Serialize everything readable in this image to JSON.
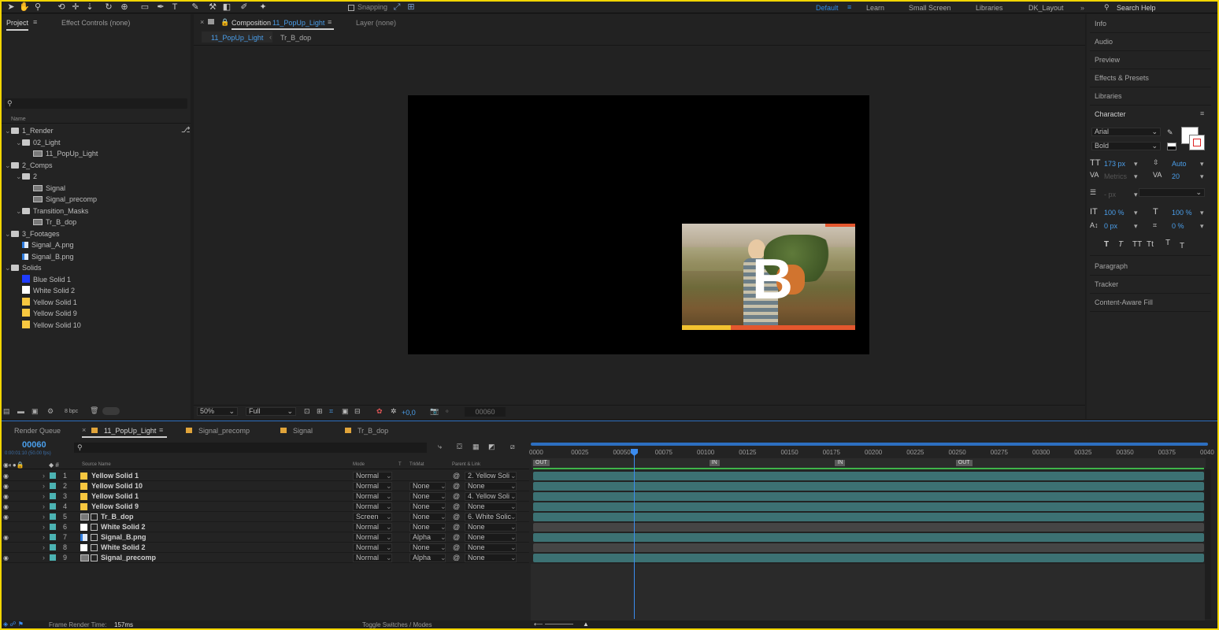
{
  "toolbar": {
    "snapping_label": "Snapping",
    "workspaces": [
      "Default",
      "Learn",
      "Small Screen",
      "Libraries",
      "DK_Layout"
    ],
    "search_placeholder": "Search Help"
  },
  "project_panel": {
    "tabs": [
      "Project",
      "Effect Controls (none)"
    ],
    "column_name": "Name",
    "items": [
      {
        "name": "1_Render",
        "type": "folder",
        "level": 0,
        "expanded": true
      },
      {
        "name": "02_Light",
        "type": "folder",
        "level": 1,
        "expanded": true
      },
      {
        "name": "11_PopUp_Light",
        "type": "comp",
        "level": 2
      },
      {
        "name": "2_Comps",
        "type": "folder",
        "level": 0,
        "expanded": true
      },
      {
        "name": "2",
        "type": "folder",
        "level": 1,
        "expanded": true
      },
      {
        "name": "Signal",
        "type": "comp",
        "level": 2
      },
      {
        "name": "Signal_precomp",
        "type": "comp",
        "level": 2
      },
      {
        "name": "Transition_Masks",
        "type": "folder",
        "level": 1,
        "expanded": true
      },
      {
        "name": "Tr_B_dop",
        "type": "comp",
        "level": 2
      },
      {
        "name": "3_Footages",
        "type": "folder",
        "level": 0,
        "expanded": true
      },
      {
        "name": "Signal_A.png",
        "type": "file",
        "level": 1
      },
      {
        "name": "Signal_B.png",
        "type": "file",
        "level": 1
      },
      {
        "name": "Solids",
        "type": "folder",
        "level": 0,
        "expanded": true
      },
      {
        "name": "Blue Solid 1",
        "type": "solid",
        "color": "#1f3cff",
        "level": 1
      },
      {
        "name": "White Solid 2",
        "type": "solid",
        "color": "#ffffff",
        "level": 1
      },
      {
        "name": "Yellow Solid 1",
        "type": "solid",
        "color": "#f7c740",
        "level": 1
      },
      {
        "name": "Yellow Solid 9",
        "type": "solid",
        "color": "#f7c740",
        "level": 1
      },
      {
        "name": "Yellow Solid 10",
        "type": "solid",
        "color": "#f7c740",
        "level": 1
      }
    ],
    "bpc": "8 bpc"
  },
  "composition_panel": {
    "tab_prefix": "Composition",
    "tab_comp": "11_PopUp_Light",
    "layer_tab": "Layer  (none)",
    "breadcrumbs": [
      "11_PopUp_Light",
      "Tr_B_dop"
    ],
    "letter": "B",
    "zoom": "50%",
    "resolution": "Full",
    "exposure": "+0,0",
    "frame": "00060",
    "colors": {
      "stripe_yellow": "#f2c230",
      "stripe_orange": "#e4572e"
    }
  },
  "right_panel": {
    "items_top": [
      "Info",
      "Audio",
      "Preview",
      "Effects & Presets",
      "Libraries"
    ],
    "character": {
      "title": "Character",
      "font": "Arial",
      "style": "Bold",
      "size": "173 px",
      "leading": "Auto",
      "kerning": "Metrics",
      "tracking": "20",
      "stroke_unit": "- px",
      "vscale": "100 %",
      "hscale": "100 %",
      "baseline": "0 px",
      "tsume": "0 %",
      "style_buttons": [
        "T",
        "T",
        "TT",
        "Tt",
        "T",
        "T"
      ]
    },
    "items_bottom": [
      "Paragraph",
      "Tracker",
      "Content-Aware Fill"
    ]
  },
  "timeline": {
    "tabs": [
      "Render Queue",
      "11_PopUp_Light",
      "Signal_precomp",
      "Signal",
      "Tr_B_dop"
    ],
    "timecode": "00060",
    "timecode_sub": "0:00:01:10 (50.00 fps)",
    "headers": {
      "source": "Source Name",
      "mode": "Mode",
      "t": "T",
      "trkmat": "TrkMat",
      "parent": "Parent & Link"
    },
    "layers": [
      {
        "num": "1",
        "name": "Yellow Solid 1",
        "icon": "yellow",
        "mode": "Normal",
        "trkmat": "",
        "parent": "2. Yellow Soli",
        "eye": true,
        "bar": "teal"
      },
      {
        "num": "2",
        "name": "Yellow Solid 10",
        "icon": "yellow",
        "mode": "Normal",
        "trkmat": "None",
        "parent": "None",
        "eye": true,
        "bar": "teal"
      },
      {
        "num": "3",
        "name": "Yellow Solid 1",
        "icon": "yellow",
        "mode": "Normal",
        "trkmat": "None",
        "parent": "4. Yellow Soli",
        "eye": true,
        "bar": "teal"
      },
      {
        "num": "4",
        "name": "Yellow Solid 9",
        "icon": "yellow",
        "mode": "Normal",
        "trkmat": "None",
        "parent": "None",
        "eye": true,
        "bar": "teal"
      },
      {
        "num": "5",
        "name": "Tr_B_dop",
        "icon": "comp",
        "mode": "Screen",
        "trkmat": "None",
        "parent": "6. White Solic",
        "eye": true,
        "bar": "teal"
      },
      {
        "num": "6",
        "name": "White Solid 2",
        "icon": "white",
        "mode": "Normal",
        "trkmat": "None",
        "parent": "None",
        "eye": false,
        "bar": "gray"
      },
      {
        "num": "7",
        "name": "Signal_B.png",
        "icon": "file",
        "mode": "Normal",
        "trkmat": "Alpha",
        "parent": "None",
        "eye": true,
        "bar": "teal"
      },
      {
        "num": "8",
        "name": "White Solid 2",
        "icon": "white",
        "mode": "Normal",
        "trkmat": "None",
        "parent": "None",
        "eye": false,
        "bar": "gray"
      },
      {
        "num": "9",
        "name": "Signal_precomp",
        "icon": "comp",
        "mode": "Normal",
        "trkmat": "Alpha",
        "parent": "None",
        "eye": true,
        "bar": "teal"
      }
    ],
    "ruler": [
      "0000",
      "00025",
      "00050",
      "00075",
      "00100",
      "00125",
      "00150",
      "00175",
      "00200",
      "00225",
      "00250",
      "00275",
      "00300",
      "00325",
      "00350",
      "00375",
      "0040"
    ],
    "markers": [
      {
        "label": "OUT",
        "frame": 0
      },
      {
        "label": "IN",
        "frame": 105
      },
      {
        "label": "IN",
        "frame": 180
      },
      {
        "label": "OUT",
        "frame": 252
      }
    ],
    "footer_render": "Frame Render Time:",
    "footer_time": "157ms",
    "footer_toggle": "Toggle Switches / Modes"
  }
}
